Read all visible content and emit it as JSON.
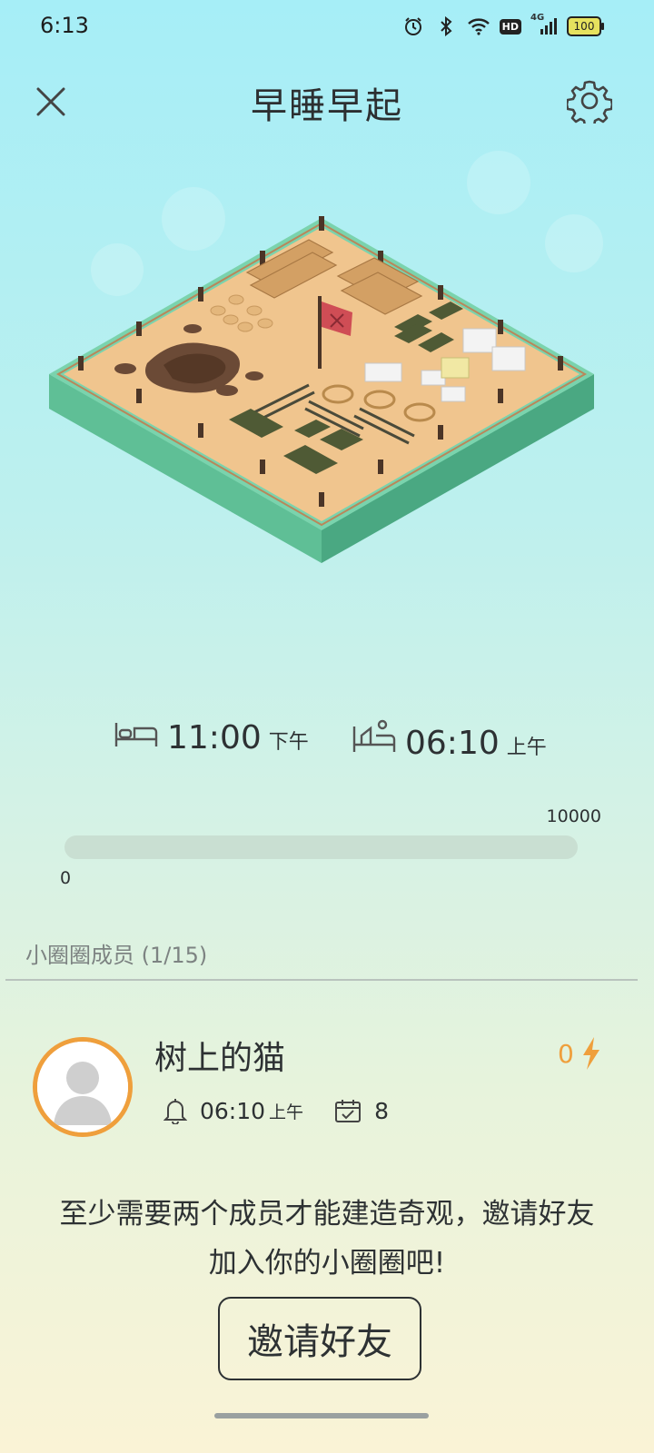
{
  "status_bar": {
    "time": "6:13",
    "network": "4G",
    "hd_label": "HD",
    "battery": "100",
    "icons": [
      "alarm-icon",
      "bluetooth-icon",
      "wifi-icon",
      "hd-icon",
      "signal-icon",
      "battery-icon"
    ]
  },
  "header": {
    "title": "早睡早起",
    "close_icon": "close-icon",
    "settings_icon": "gear-icon"
  },
  "schedule": {
    "sleep_time": "11:00",
    "sleep_ampm": "下午",
    "wake_time": "06:10",
    "wake_ampm": "上午",
    "sleep_icon": "bed-icon",
    "wake_icon": "wake-up-icon"
  },
  "progress": {
    "min": "0",
    "max": "10000",
    "value_fraction": 0
  },
  "members": {
    "label": "小圈圈成员 (1/15)",
    "list": [
      {
        "name": "树上的猫",
        "score": "0",
        "alarm_time": "06:10",
        "alarm_ampm": "上午",
        "checkin_days": "8"
      }
    ]
  },
  "notice": {
    "line1": "至少需要两个成员才能建造奇观，邀请好友",
    "line2": "加入你的小圈圈吧!"
  },
  "invite_button": "邀请好友",
  "colors": {
    "accent_orange": "#ef9f3c",
    "ground_sand": "#f0c58e",
    "ground_green": "#6fcca3"
  }
}
